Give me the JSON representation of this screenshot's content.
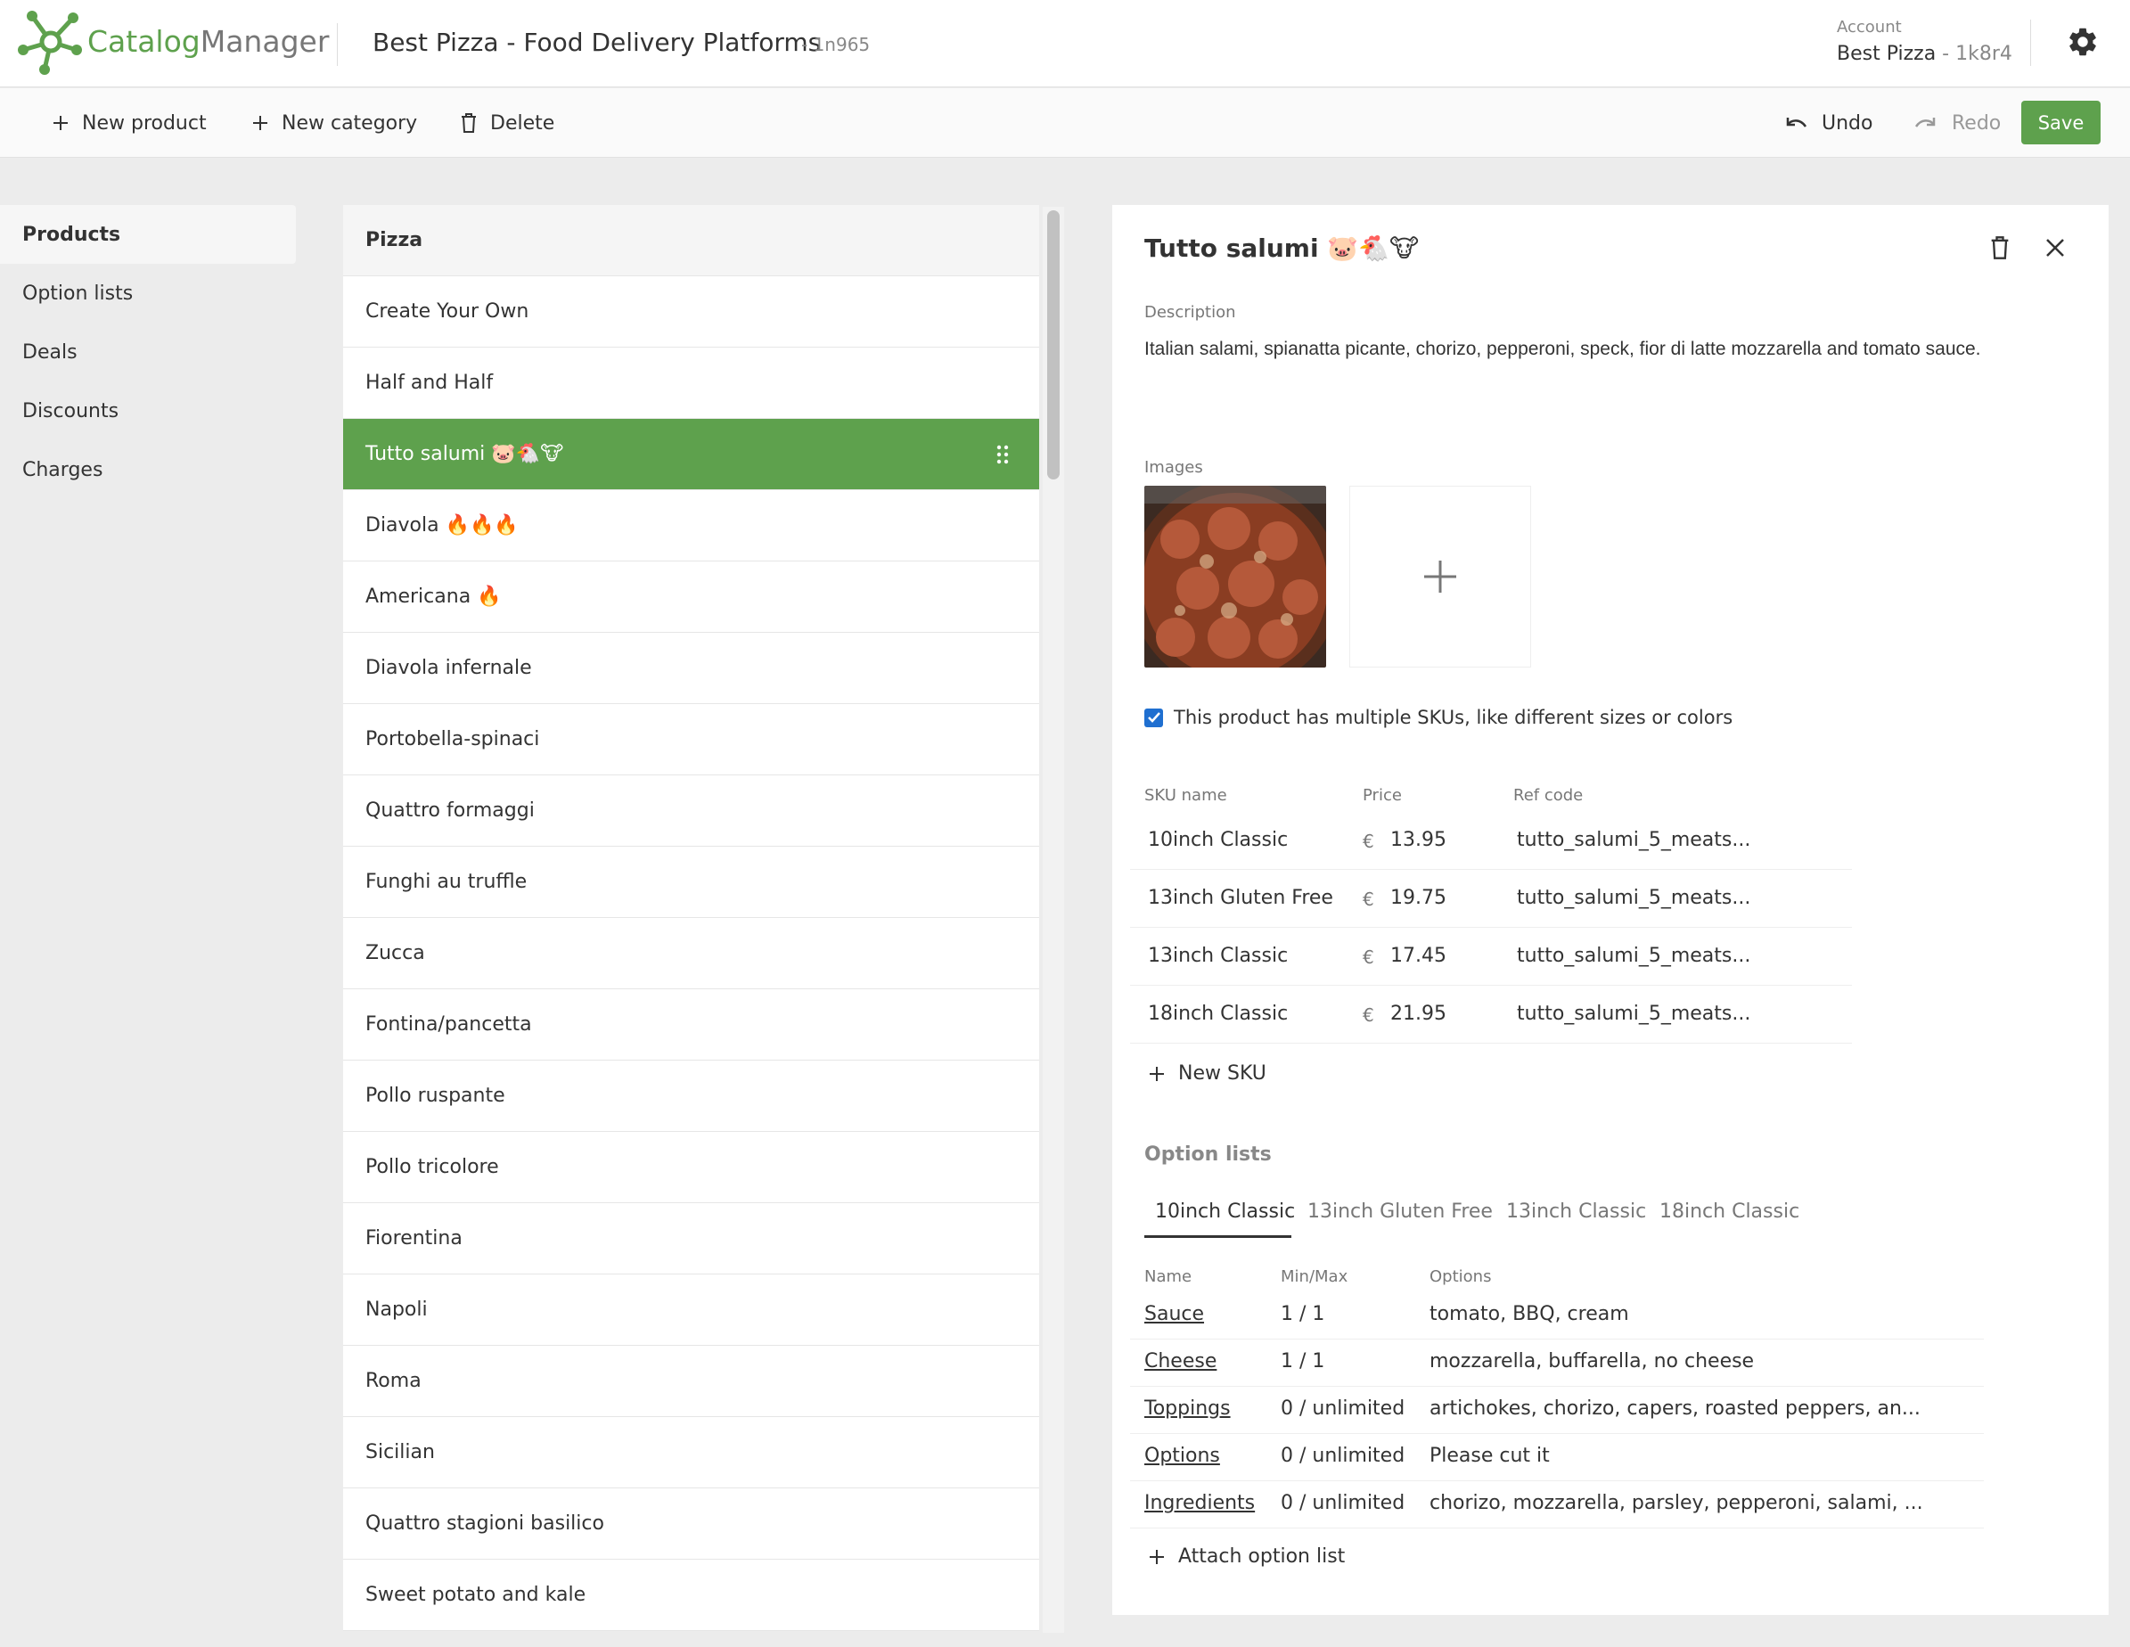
{
  "header": {
    "brand_a": "Catalog",
    "brand_b": "Manager",
    "project_title": "Best Pizza - Food Delivery Platforms",
    "project_code": "- 1n965",
    "account_label": "Account",
    "account_name": "Best Pizza",
    "account_code": " - 1k8r4"
  },
  "toolbar": {
    "new_product": "New product",
    "new_category": "New category",
    "delete": "Delete",
    "undo": "Undo",
    "redo": "Redo",
    "save": "Save"
  },
  "sidebar": {
    "items": [
      {
        "label": "Products",
        "active": true
      },
      {
        "label": "Option lists"
      },
      {
        "label": "Deals"
      },
      {
        "label": "Discounts"
      },
      {
        "label": "Charges"
      }
    ]
  },
  "product_list": {
    "category": "Pizza",
    "items": [
      "Create Your Own",
      "Half and Half",
      "Tutto salumi 🐷🐔🐮",
      "Diavola 🔥🔥🔥",
      "Americana 🔥",
      "Diavola infernale",
      "Portobella-spinaci",
      "Quattro formaggi",
      "Funghi au truffle",
      "Zucca",
      "Fontina/pancetta",
      "Pollo ruspante",
      "Pollo tricolore",
      "Fiorentina",
      "Napoli",
      "Roma",
      "Sicilian",
      "Quattro stagioni basilico",
      "Sweet potato and kale"
    ],
    "selected_index": 2
  },
  "detail": {
    "title": "Tutto salumi 🐷🐔🐮",
    "description_label": "Description",
    "description": "Italian salami, spianatta picante, chorizo, pepperoni, speck, fior di latte mozzarella and tomato sauce.",
    "images_label": "Images",
    "multi_sku_label": "This product has multiple SKUs, like different sizes or colors",
    "sku_headers": {
      "name": "SKU name",
      "price": "Price",
      "ref": "Ref code"
    },
    "currency": "€",
    "skus": [
      {
        "name": "10inch Classic",
        "price": "13.95",
        "ref": "tutto_salumi_5_meats..."
      },
      {
        "name": "13inch Gluten Free",
        "price": "19.75",
        "ref": "tutto_salumi_5_meats..."
      },
      {
        "name": "13inch Classic",
        "price": "17.45",
        "ref": "tutto_salumi_5_meats..."
      },
      {
        "name": "18inch Classic",
        "price": "21.95",
        "ref": "tutto_salumi_5_meats..."
      }
    ],
    "new_sku": "New SKU",
    "option_lists_title": "Option lists",
    "tabs": [
      "10inch Classic",
      "13inch Gluten Free",
      "13inch Classic",
      "18inch Classic"
    ],
    "option_headers": {
      "name": "Name",
      "minmax": "Min/Max",
      "options": "Options"
    },
    "option_lists": [
      {
        "name": "Sauce",
        "minmax": "1 / 1",
        "options": "tomato, BBQ, cream"
      },
      {
        "name": "Cheese",
        "minmax": "1 / 1",
        "options": "mozzarella, buffarella, no cheese"
      },
      {
        "name": "Toppings",
        "minmax": "0 / unlimited",
        "options": "artichokes, chorizo, capers, roasted peppers, an..."
      },
      {
        "name": "Options",
        "minmax": "0 / unlimited",
        "options": "Please cut it"
      },
      {
        "name": "Ingredients",
        "minmax": "0 / unlimited",
        "options": "chorizo, mozzarella, parsley, pepperoni, salami, ..."
      }
    ],
    "attach_option_list": "Attach option list"
  }
}
